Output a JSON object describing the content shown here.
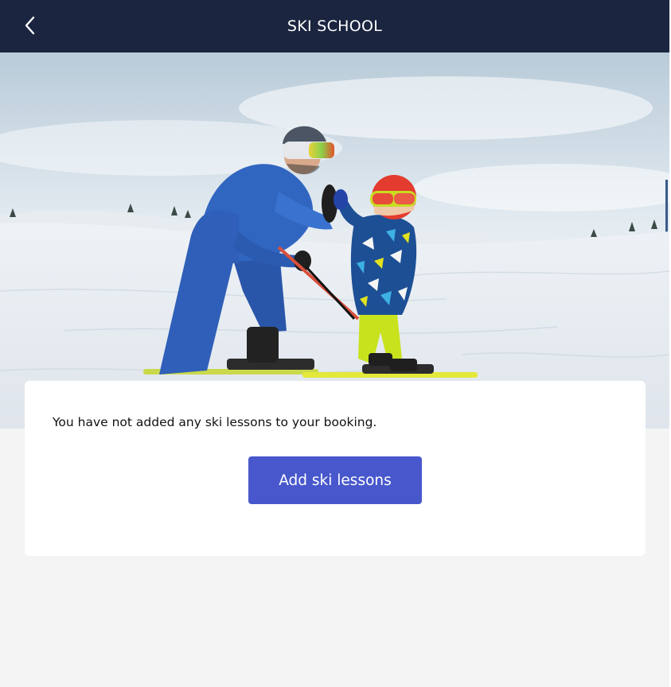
{
  "header": {
    "title": "SKI SCHOOL",
    "back_icon": "chevron-left-icon"
  },
  "hero": {
    "image": "ski instructor high-fiving child on snowy slope"
  },
  "empty_state": {
    "message": "You have not added any ski lessons to your booking.",
    "button_label": "Add ski lessons"
  },
  "colors": {
    "header_bg": "#1b2540",
    "accent": "#4858cc",
    "page_bg": "#f4f4f4"
  }
}
